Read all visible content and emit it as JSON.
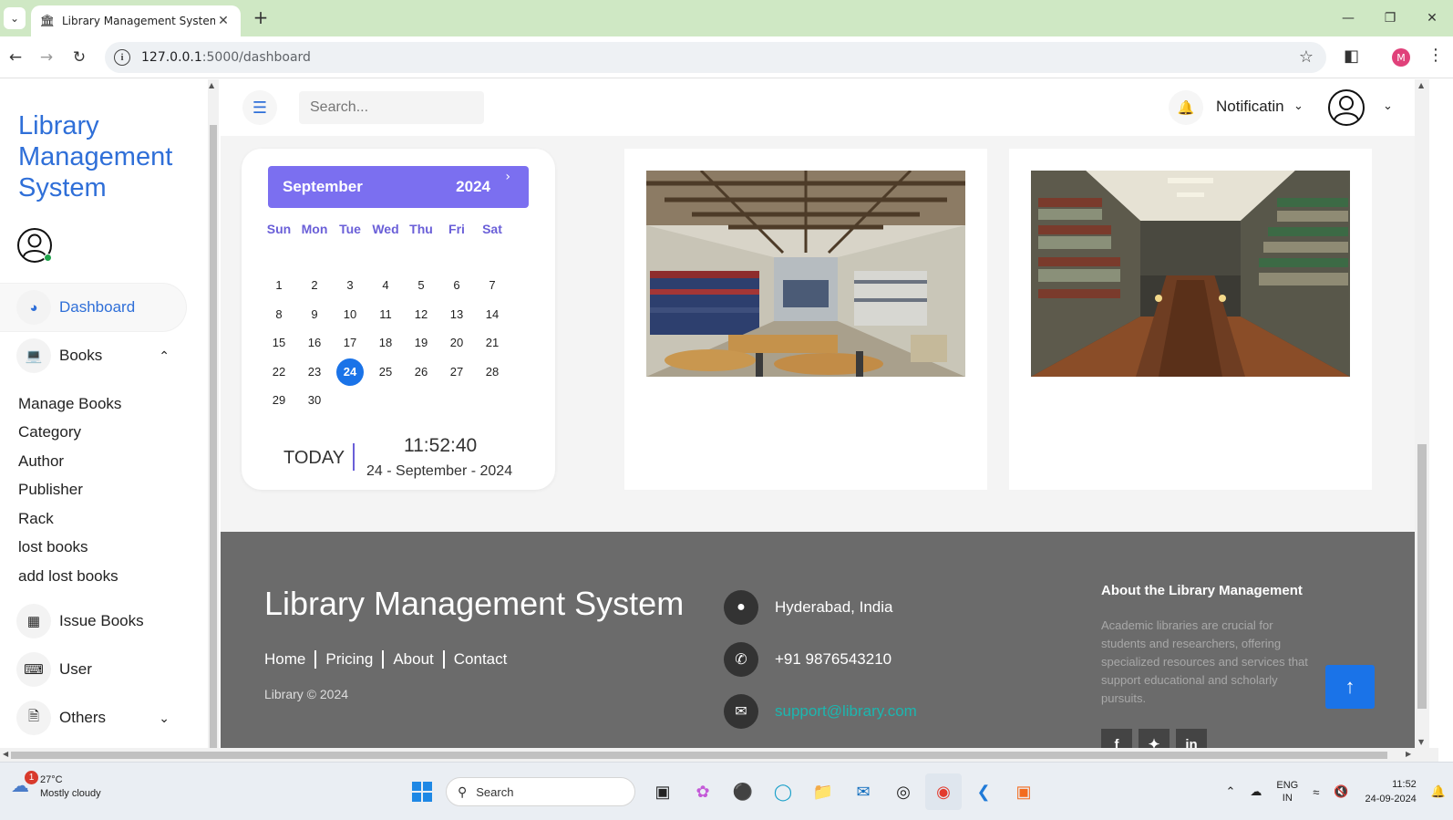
{
  "browser": {
    "tab_title": "Library Management System",
    "url_host": "127.0.0.1",
    "url_path": ":5000/dashboard",
    "profile_initial": "M"
  },
  "sidebar": {
    "brand": "Library Management System",
    "items": {
      "dashboard": "Dashboard",
      "books": "Books",
      "issue_books": "Issue Books",
      "user": "User",
      "others": "Others"
    },
    "books_sub": [
      "Manage Books",
      "Category",
      "Author",
      "Publisher",
      "Rack",
      "lost books",
      "add lost books"
    ]
  },
  "topbar": {
    "search_placeholder": "Search...",
    "notification_label": "Notificatin"
  },
  "calendar": {
    "month": "September",
    "year": "2024",
    "weekdays": [
      "Sun",
      "Mon",
      "Tue",
      "Wed",
      "Thu",
      "Fri",
      "Sat"
    ],
    "first_weekday_index": 0,
    "days_in_month": 30,
    "selected_day": 24,
    "today_label": "TODAY",
    "time": "11:52:40",
    "date_text": "24 - September - 2024"
  },
  "footer": {
    "title": "Library Management System",
    "links": [
      "Home",
      "Pricing",
      "About",
      "Contact"
    ],
    "copyright": "Library © 2024",
    "address": "Hyderabad, India",
    "phone": "+91 9876543210",
    "email": "support@library.com",
    "about_title": "About the Library Management",
    "about_text": "Academic libraries are crucial for students and researchers, offering specialized resources and services that support educational and scholarly pursuits."
  },
  "taskbar": {
    "temperature": "27°C",
    "weather": "Mostly cloudy",
    "weather_badge": "1",
    "search_label": "Search",
    "lang_top": "ENG",
    "lang_bottom": "IN",
    "time": "11:52",
    "date": "24-09-2024"
  },
  "colors": {
    "accent_blue": "#2f6fd8",
    "calendar_header": "#7b6ff0",
    "today_circle": "#1a73e8",
    "footer_bg": "#6b6b6b",
    "email_link": "#1bb7b0"
  }
}
